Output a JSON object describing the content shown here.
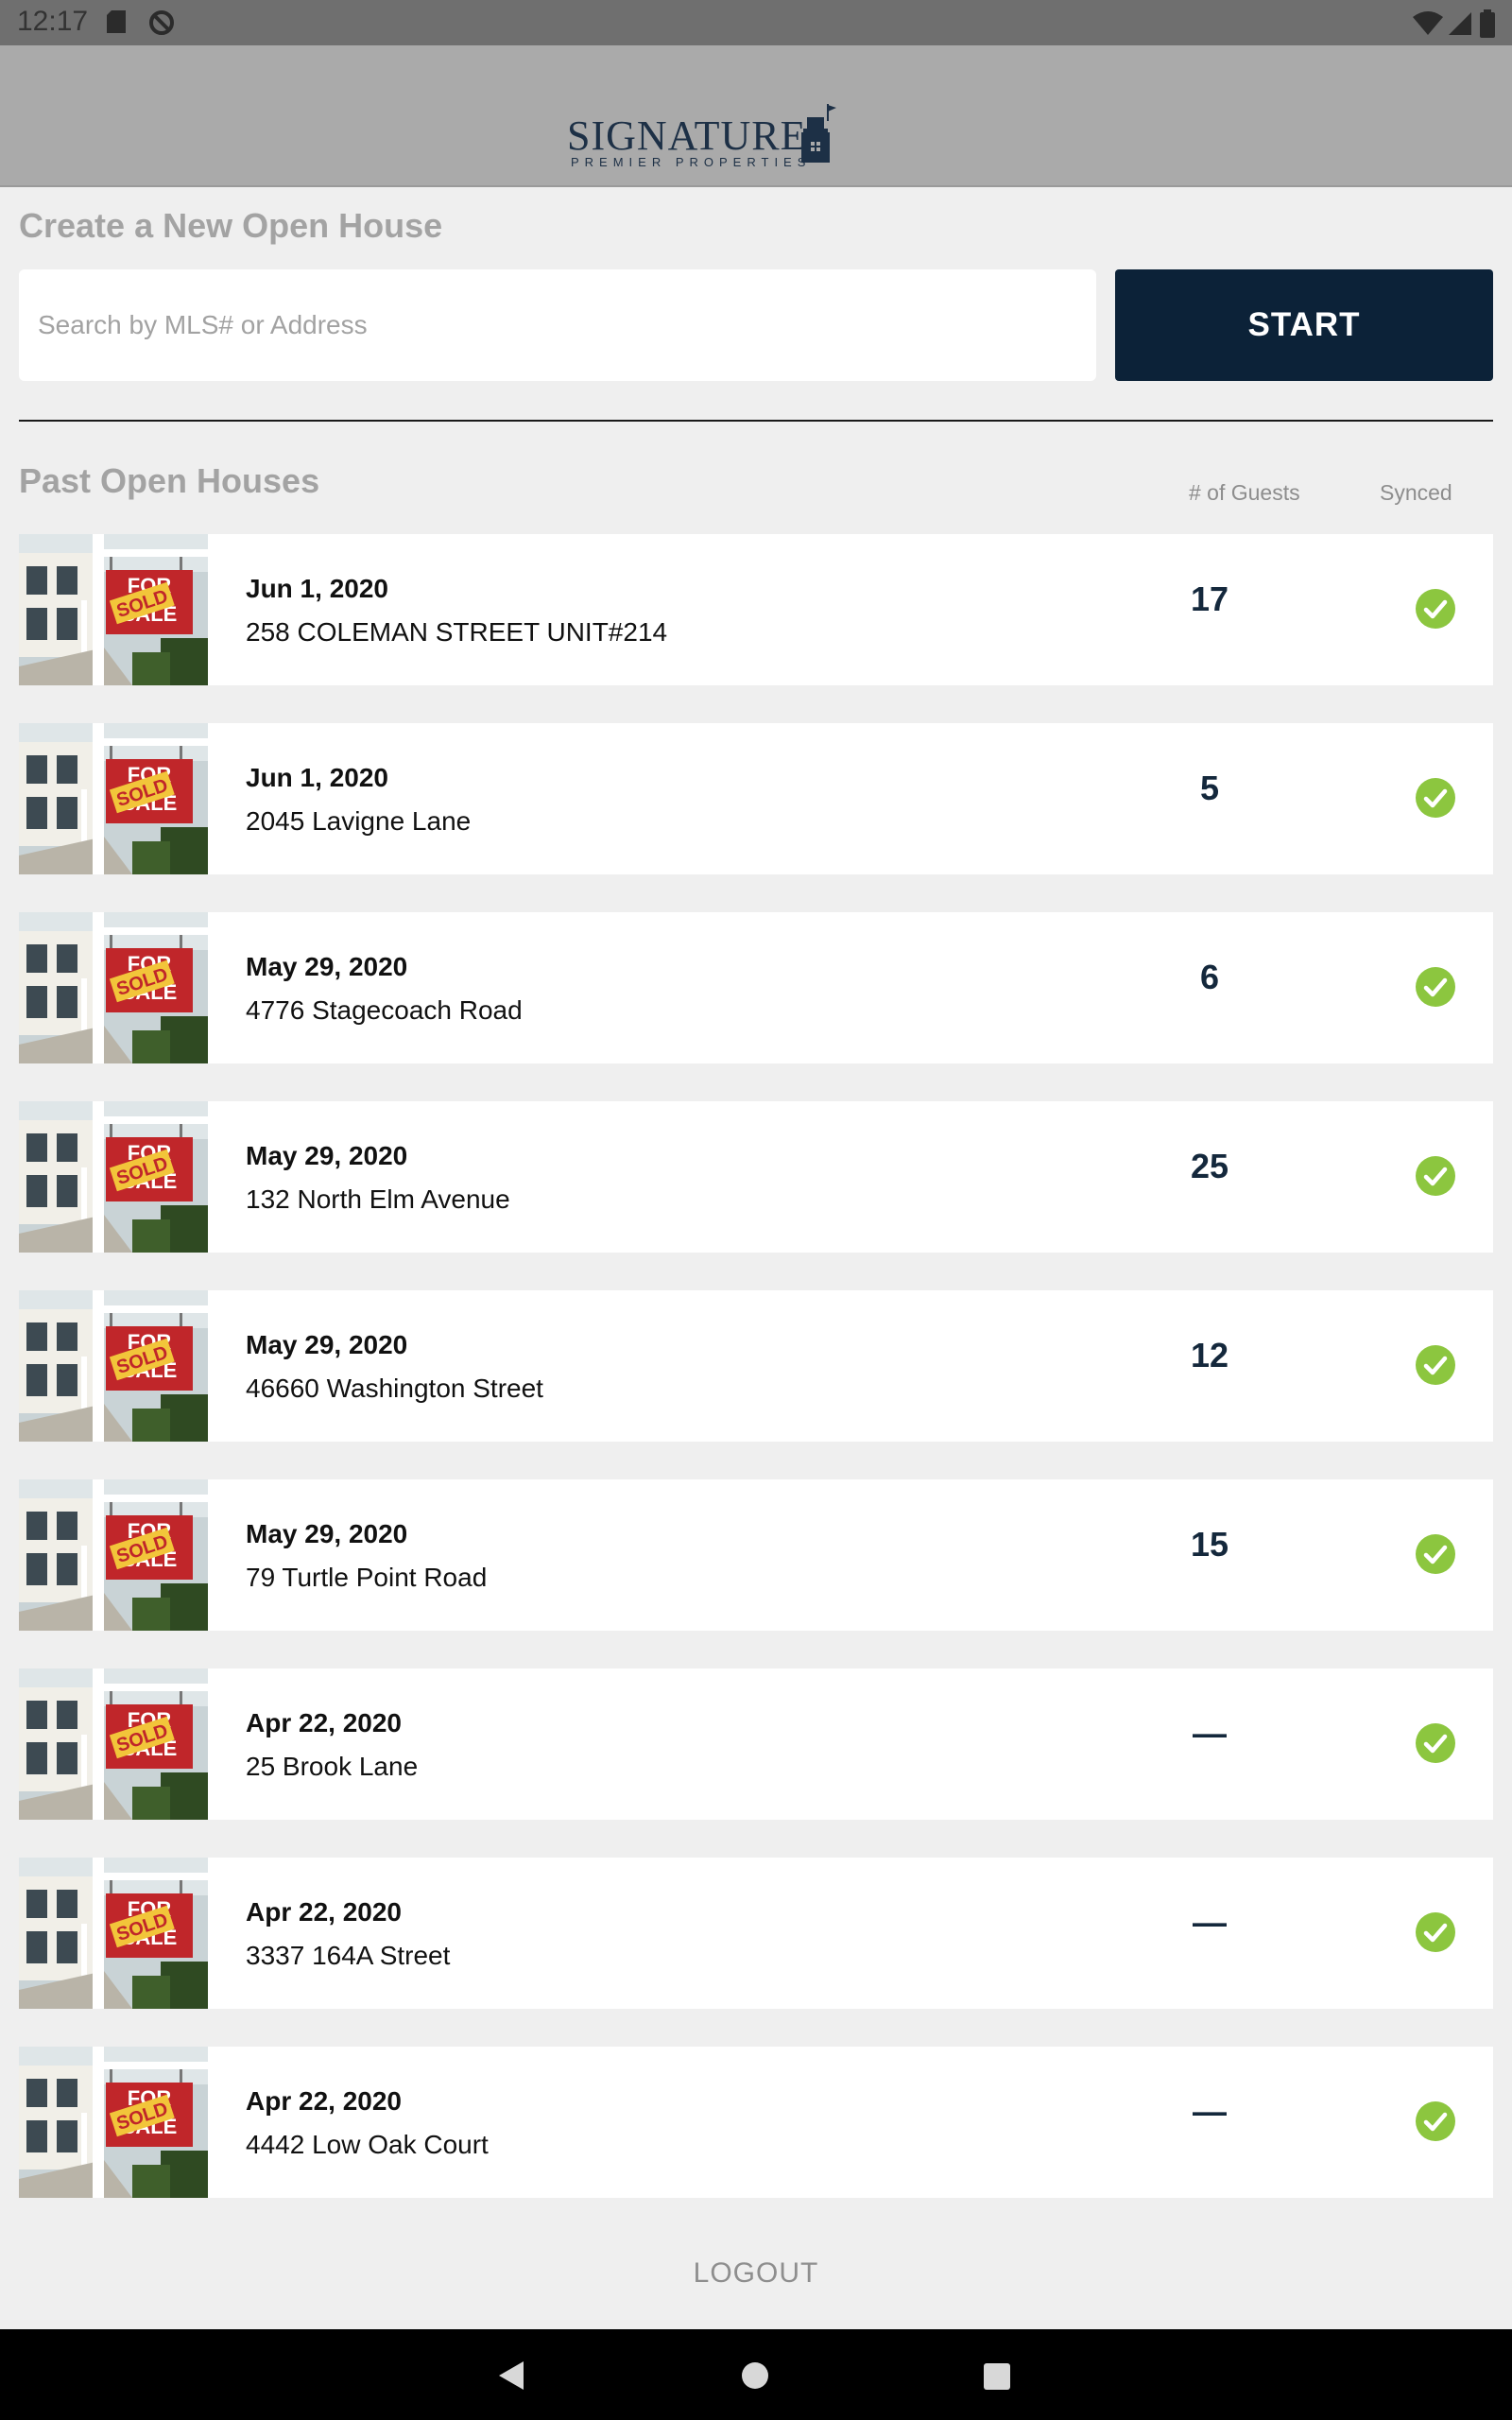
{
  "status_bar": {
    "time": "12:17"
  },
  "header": {
    "logo_main": "SIGNATURE",
    "logo_sub": "PREMIER PROPERTIES"
  },
  "create": {
    "title": "Create a New Open House",
    "search_placeholder": "Search by MLS# or Address",
    "search_value": "",
    "start_label": "START"
  },
  "past": {
    "title": "Past Open Houses",
    "col_guests": "# of Guests",
    "col_synced": "Synced",
    "items": [
      {
        "date": "Jun 1, 2020",
        "address": "258 COLEMAN STREET UNIT#214",
        "guests": "17",
        "synced": true
      },
      {
        "date": "Jun 1, 2020",
        "address": "2045 Lavigne Lane",
        "guests": "5",
        "synced": true
      },
      {
        "date": "May 29, 2020",
        "address": "4776 Stagecoach Road",
        "guests": "6",
        "synced": true
      },
      {
        "date": "May 29, 2020",
        "address": "132 North Elm Avenue",
        "guests": "25",
        "synced": true
      },
      {
        "date": "May 29, 2020",
        "address": "46660 Washington Street",
        "guests": "12",
        "synced": true
      },
      {
        "date": "May 29, 2020",
        "address": "79 Turtle Point Road",
        "guests": "15",
        "synced": true
      },
      {
        "date": "Apr 22, 2020",
        "address": "25 Brook Lane",
        "guests": "—",
        "synced": true
      },
      {
        "date": "Apr 22, 2020",
        "address": "3337 164A Street",
        "guests": "—",
        "synced": true
      },
      {
        "date": "Apr 22, 2020",
        "address": "4442 Low Oak Court",
        "guests": "—",
        "synced": true
      }
    ]
  },
  "thumbnail": {
    "sign_text_top": "FOR",
    "sign_text_bottom": "SALE",
    "sticker_text": "SOLD"
  },
  "logout_label": "LOGOUT",
  "colors": {
    "header_bg": "#aaaaaa",
    "start_bg": "#0c2238",
    "synced_green": "#8cc63f",
    "status_bar": "#6f6f6f",
    "nav_bar": "#000000"
  }
}
